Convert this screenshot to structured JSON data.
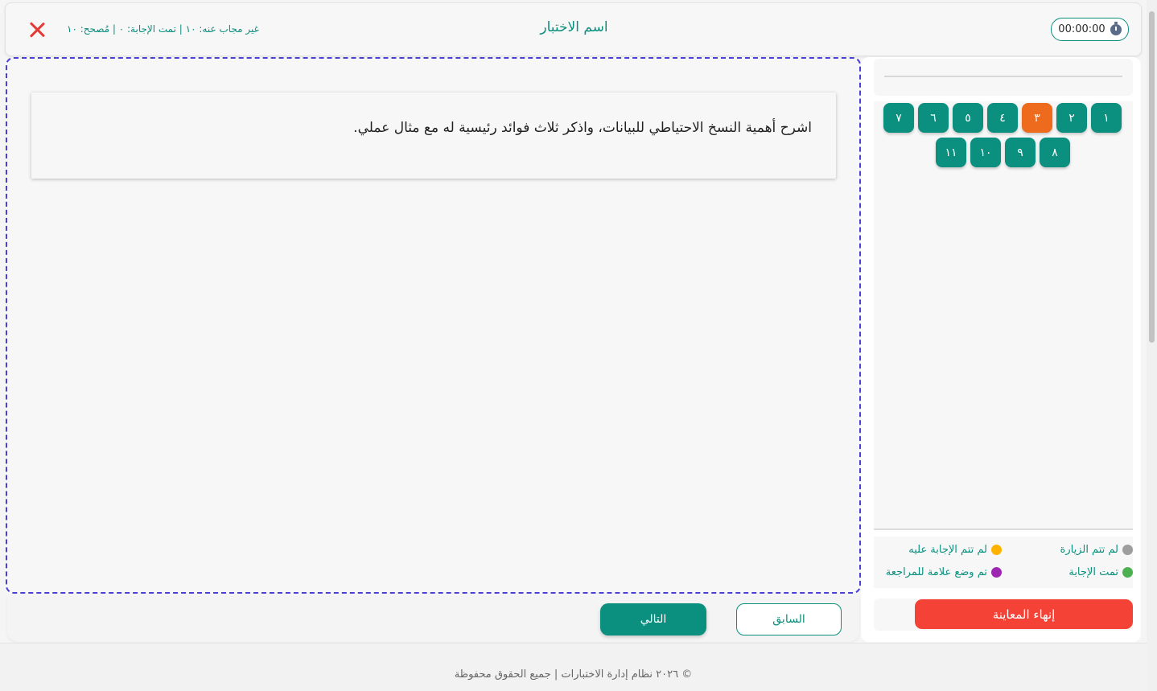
{
  "header": {
    "timer": "00:00:00",
    "title": "اسم الاختبار",
    "stats": "غير مجاب عنه: ١٠ | تمت الإجابة: ٠ | مُصحح: ١٠"
  },
  "question": {
    "text": "اشرح أهمية النسخ الاحتياطي للبيانات، واذكر ثلاث فوائد رئيسية له مع مثال عملي."
  },
  "navigation": {
    "prev_label": "السابق",
    "next_label": "التالي"
  },
  "question_nav": {
    "current": "٣",
    "items": [
      "١",
      "٢",
      "٣",
      "٤",
      "٥",
      "٦",
      "٧",
      "٨",
      "٩",
      "١٠",
      "١١"
    ]
  },
  "legend": {
    "not_visited": {
      "label": "لم تتم الزيارة",
      "color": "#9e9e9e"
    },
    "not_answered": {
      "label": "لم تتم الإجابة عليه",
      "color": "#ffb300"
    },
    "answered": {
      "label": "تمت الإجابة",
      "color": "#4caf50"
    },
    "marked_review": {
      "label": "تم وضع علامة للمراجعة",
      "color": "#9c27b0"
    }
  },
  "finish_label": "إنهاء المعاينة",
  "footer": {
    "text": "© ٢٠٢٦ نظام إدارة الاختبارات | جميع الحقوق محفوظة"
  },
  "colors": {
    "primary": "#0b8f7f",
    "current_question": "#ee6a1c",
    "danger": "#f44336",
    "dashed_border": "#4a3fd6"
  }
}
